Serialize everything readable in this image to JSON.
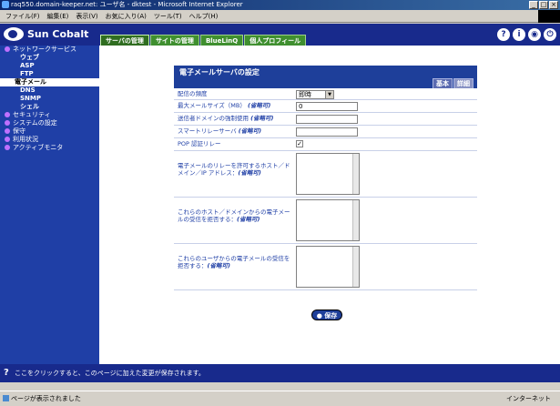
{
  "window": {
    "title": "raq550.domain-keeper.net: ユーザ名 - dktest - Microsoft Internet Explorer",
    "menu": [
      "ファイル(F)",
      "編集(E)",
      "表示(V)",
      "お気に入り(A)",
      "ツール(T)",
      "ヘルプ(H)"
    ]
  },
  "header": {
    "logo": "Sun Cobalt",
    "tabs": [
      "サーバの管理",
      "サイトの管理",
      "BlueLinQ",
      "個人プロフィール"
    ]
  },
  "sidebar": {
    "items": [
      {
        "label": "ネットワークサービス",
        "type": "group"
      },
      {
        "label": "ウェブ",
        "type": "sub"
      },
      {
        "label": "ASP",
        "type": "sub"
      },
      {
        "label": "FTP",
        "type": "sub"
      },
      {
        "label": "電子メール",
        "type": "selected"
      },
      {
        "label": "DNS",
        "type": "sub"
      },
      {
        "label": "SNMP",
        "type": "sub"
      },
      {
        "label": "シェル",
        "type": "sub"
      },
      {
        "label": "セキュリティ",
        "type": "group"
      },
      {
        "label": "システムの設定",
        "type": "group"
      },
      {
        "label": "保守",
        "type": "group"
      },
      {
        "label": "利用状況",
        "type": "group"
      },
      {
        "label": "アクティブモニタ",
        "type": "group"
      }
    ]
  },
  "panel": {
    "title": "電子メールサーバの設定",
    "tabs": [
      "基本",
      "詳細"
    ],
    "rows": {
      "frequency": {
        "label": "配信の頻度",
        "value": "即時"
      },
      "max_size": {
        "label": "最大メールサイズ（MB）",
        "optional": "(省略可)",
        "value": "0"
      },
      "masq": {
        "label": "送信者ドメインの強制使用",
        "optional": "(省略可)",
        "value": ""
      },
      "smart": {
        "label": "スマートリレーサーバ",
        "optional": "(省略可)",
        "value": ""
      },
      "pop": {
        "label": "POP 認証リレー",
        "checked": "✓"
      },
      "relay_hosts": {
        "label": "電子メールのリレーを許可するホスト／ドメイン／IP アドレス：",
        "optional": "(省略可)"
      },
      "block_hosts": {
        "label": "これらのホスト／ドメインからの電子メールの受信を拒否する：",
        "optional": "(省略可)"
      },
      "block_users": {
        "label": "これらのユーザからの電子メールの受信を拒否する：",
        "optional": "(省略可)"
      }
    },
    "save": "保存"
  },
  "footer": {
    "hint": "ここをクリックすると、このページに加えた変更が保存されます。"
  },
  "status": {
    "text": "ページが表示されました",
    "zone": "インターネット"
  }
}
